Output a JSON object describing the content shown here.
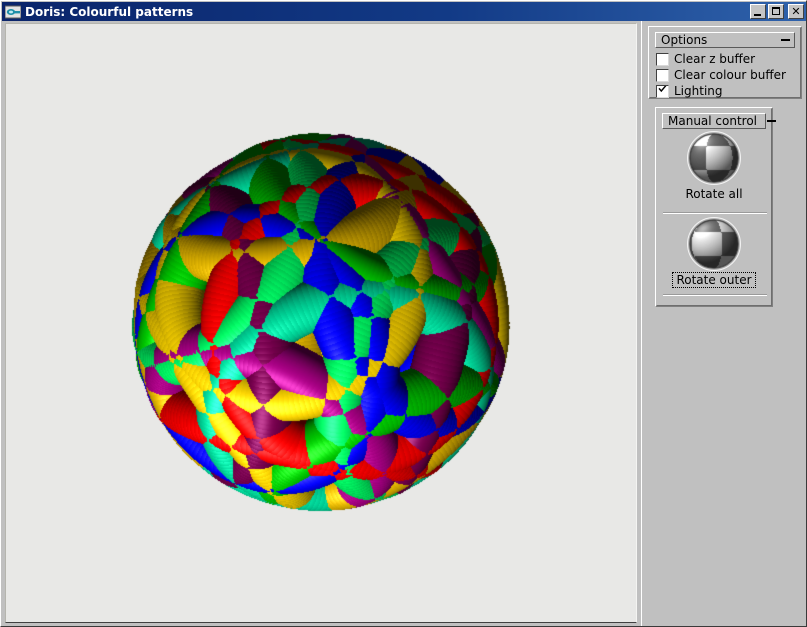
{
  "window": {
    "title": "Doris: Colourful patterns",
    "icon": "app-icon",
    "controls": {
      "minimize": {
        "name": "minimize-button",
        "glyph": "_"
      },
      "maximize": {
        "name": "maximize-button",
        "glyph": "□"
      },
      "close": {
        "name": "close-button",
        "glyph": "✕"
      }
    },
    "colors": {
      "titlebar_start": "#0a246a",
      "titlebar_end": "#2f62ab",
      "panel_bg": "#c0c0c0",
      "canvas_bg": "#e8e8e6"
    }
  },
  "render": {
    "name": "3d-render-canvas",
    "description": "Colourful 3D woven torus-knot sphere",
    "background": "#e8e8e6",
    "palette": [
      "#0000ff",
      "#ff0000",
      "#00d000",
      "#00ff66",
      "#ffd700",
      "#b0008a",
      "#00e0a0",
      "#e6b800",
      "#7b0050"
    ]
  },
  "options": {
    "title": "Options",
    "collapse_glyph": "—",
    "items": [
      {
        "label": "Clear z buffer",
        "checked": false,
        "name": "checkbox-clear-z-buffer"
      },
      {
        "label": "Clear colour buffer",
        "checked": false,
        "name": "checkbox-clear-colour-buffer"
      },
      {
        "label": "Lighting",
        "checked": true,
        "name": "checkbox-lighting"
      }
    ]
  },
  "manual_control": {
    "title": "Manual control",
    "collapse_glyph": "—",
    "items": [
      {
        "label": "Rotate all",
        "focused": false,
        "name": "rotate-all"
      },
      {
        "label": "Rotate outer",
        "focused": true,
        "name": "rotate-outer"
      }
    ]
  }
}
